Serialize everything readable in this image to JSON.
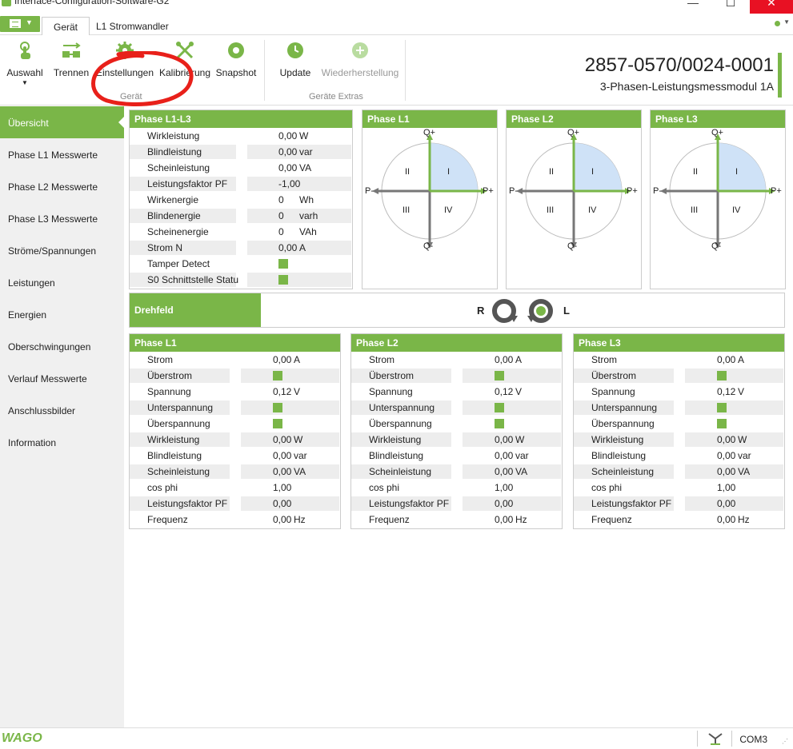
{
  "window": {
    "title": "Interface-Configuration-Software-G2",
    "minimize": "—",
    "maximize": "☐",
    "close": "✕"
  },
  "tabs": [
    {
      "label": "Gerät"
    },
    {
      "label": "L1 Stromwandler"
    }
  ],
  "ribbon": {
    "buttons": {
      "auswahl": "Auswahl",
      "trennen": "Trennen",
      "einstellungen": "Einstellungen",
      "kalibrierung": "Kalibrierung",
      "snapshot": "Snapshot",
      "update": "Update",
      "wiederherstellung": "Wiederherstellung"
    },
    "groups": {
      "geraet": "Gerät",
      "geraete_extras": "Geräte Extras"
    },
    "device_id": "2857-0570/0024-0001",
    "device_desc": "3-Phasen-Leistungsmessmodul 1A"
  },
  "sidebar": {
    "items": [
      "Übersicht",
      "Phase L1 Messwerte",
      "Phase L2 Messwerte",
      "Phase L3 Messwerte",
      "Ströme/Spannungen",
      "Leistungen",
      "Energien",
      "Oberschwingungen",
      "Verlauf Messwerte",
      "Anschlussbilder",
      "Information"
    ]
  },
  "summary": {
    "title": "Phase L1-L3",
    "rows": [
      {
        "label": "Wirkleistung",
        "value": "0,00",
        "unit": "W"
      },
      {
        "label": "Blindleistung",
        "value": "0,00",
        "unit": "var"
      },
      {
        "label": "Scheinleistung",
        "value": "0,00",
        "unit": "VA"
      },
      {
        "label": "Leistungsfaktor PF",
        "value": "-1,00",
        "unit": ""
      },
      {
        "label": "Wirkenergie",
        "value": "0",
        "unit": "Wh"
      },
      {
        "label": "Blindenergie",
        "value": "0",
        "unit": "varh"
      },
      {
        "label": "Scheinenergie",
        "value": "0",
        "unit": "VAh"
      },
      {
        "label": "Strom  N",
        "value": "0,00",
        "unit": "A"
      },
      {
        "label": "Tamper Detect",
        "indicator": true
      },
      {
        "label": "S0 Schnittstelle Statu",
        "indicator": true
      }
    ]
  },
  "quadrants": {
    "panels": [
      "Phase L1",
      "Phase L2",
      "Phase L3"
    ],
    "labels": {
      "q_plus": "Q+",
      "q_minus": "Q-",
      "p_plus": "P+",
      "p_minus": "P-",
      "i": "I",
      "ii": "II",
      "iii": "III",
      "iv": "IV"
    }
  },
  "drehfeld": {
    "title": "Drehfeld",
    "r": "R",
    "l": "L"
  },
  "phase_panels": [
    {
      "title": "Phase L1"
    },
    {
      "title": "Phase L2"
    },
    {
      "title": "Phase L3"
    }
  ],
  "phase_rows": [
    {
      "label": "Strom",
      "value": "0,00",
      "unit": "A"
    },
    {
      "label": "Überstrom",
      "indicator": true
    },
    {
      "label": "Spannung",
      "value": "0,12",
      "unit": "V"
    },
    {
      "label": "Unterspannung",
      "indicator": true
    },
    {
      "label": "Überspannung",
      "indicator": true
    },
    {
      "label": "Wirkleistung",
      "value": "0,00",
      "unit": "W"
    },
    {
      "label": "Blindleistung",
      "value": "0,00",
      "unit": "var"
    },
    {
      "label": "Scheinleistung",
      "value": "0,00",
      "unit": "VA"
    },
    {
      "label": "cos phi",
      "value": "1,00",
      "unit": ""
    },
    {
      "label": "Leistungsfaktor PF",
      "value": "0,00",
      "unit": ""
    },
    {
      "label": "Frequenz",
      "value": "0,00",
      "unit": "Hz"
    }
  ],
  "statusbar": {
    "brand": "WAGO",
    "port": "COM3"
  },
  "colors": {
    "accent": "#7ab648",
    "close": "#e81123",
    "quadrant_fill": "#cfe2f7",
    "annotation": "#e8201a"
  }
}
